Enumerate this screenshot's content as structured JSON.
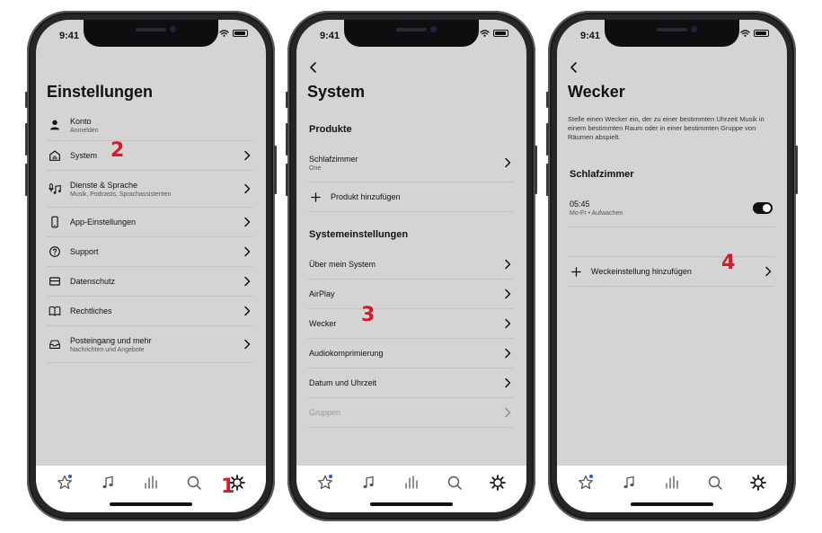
{
  "status_time": "9:41",
  "phone1": {
    "title": "Einstellungen",
    "items": [
      {
        "label": "Konto",
        "sub": "Anmelden"
      },
      {
        "label": "System",
        "sub": ""
      },
      {
        "label": "Dienste & Sprache",
        "sub": "Musik, Podcasts, Sprachassistenten"
      },
      {
        "label": "App-Einstellungen",
        "sub": ""
      },
      {
        "label": "Support",
        "sub": ""
      },
      {
        "label": "Datenschutz",
        "sub": ""
      },
      {
        "label": "Rechtliches",
        "sub": ""
      },
      {
        "label": "Posteingang und mehr",
        "sub": "Nachrichten und Angebote"
      }
    ]
  },
  "phone2": {
    "title": "System",
    "section_products": "Produkte",
    "product_name": "Schlafzimmer",
    "product_sub": "One",
    "add_product": "Produkt hinzufügen",
    "section_settings": "Systemeinstellungen",
    "items": [
      {
        "label": "Über mein System"
      },
      {
        "label": "AirPlay"
      },
      {
        "label": "Wecker"
      },
      {
        "label": "Audiokomprimierung"
      },
      {
        "label": "Datum und Uhrzeit"
      },
      {
        "label": "Gruppen"
      }
    ]
  },
  "phone3": {
    "title": "Wecker",
    "description": "Stelle einen Wecker ein, der zu einer bestimmten Uhrzeit Musik in einem bestimmten Raum oder in einer bestimmten Gruppe von Räumen abspielt.",
    "section_room": "Schlafzimmer",
    "alarm_time": "05:45",
    "alarm_sub": "Mo-Fr • Aufwachen",
    "alarm_enabled": true,
    "add_alarm": "Weckeinstellung hinzufügen"
  },
  "tabs": [
    {
      "icon": "star-icon",
      "name": "favorites"
    },
    {
      "icon": "music-note-icon",
      "name": "browse"
    },
    {
      "icon": "equalizer-icon",
      "name": "rooms"
    },
    {
      "icon": "search-icon",
      "name": "search"
    },
    {
      "icon": "gear-icon",
      "name": "settings"
    }
  ],
  "steps": [
    "1",
    "2",
    "3",
    "4"
  ],
  "colors": {
    "badge": "#d9192b",
    "tab_dot": "#2b56e0",
    "screen_bg": "#d4d4d4"
  }
}
